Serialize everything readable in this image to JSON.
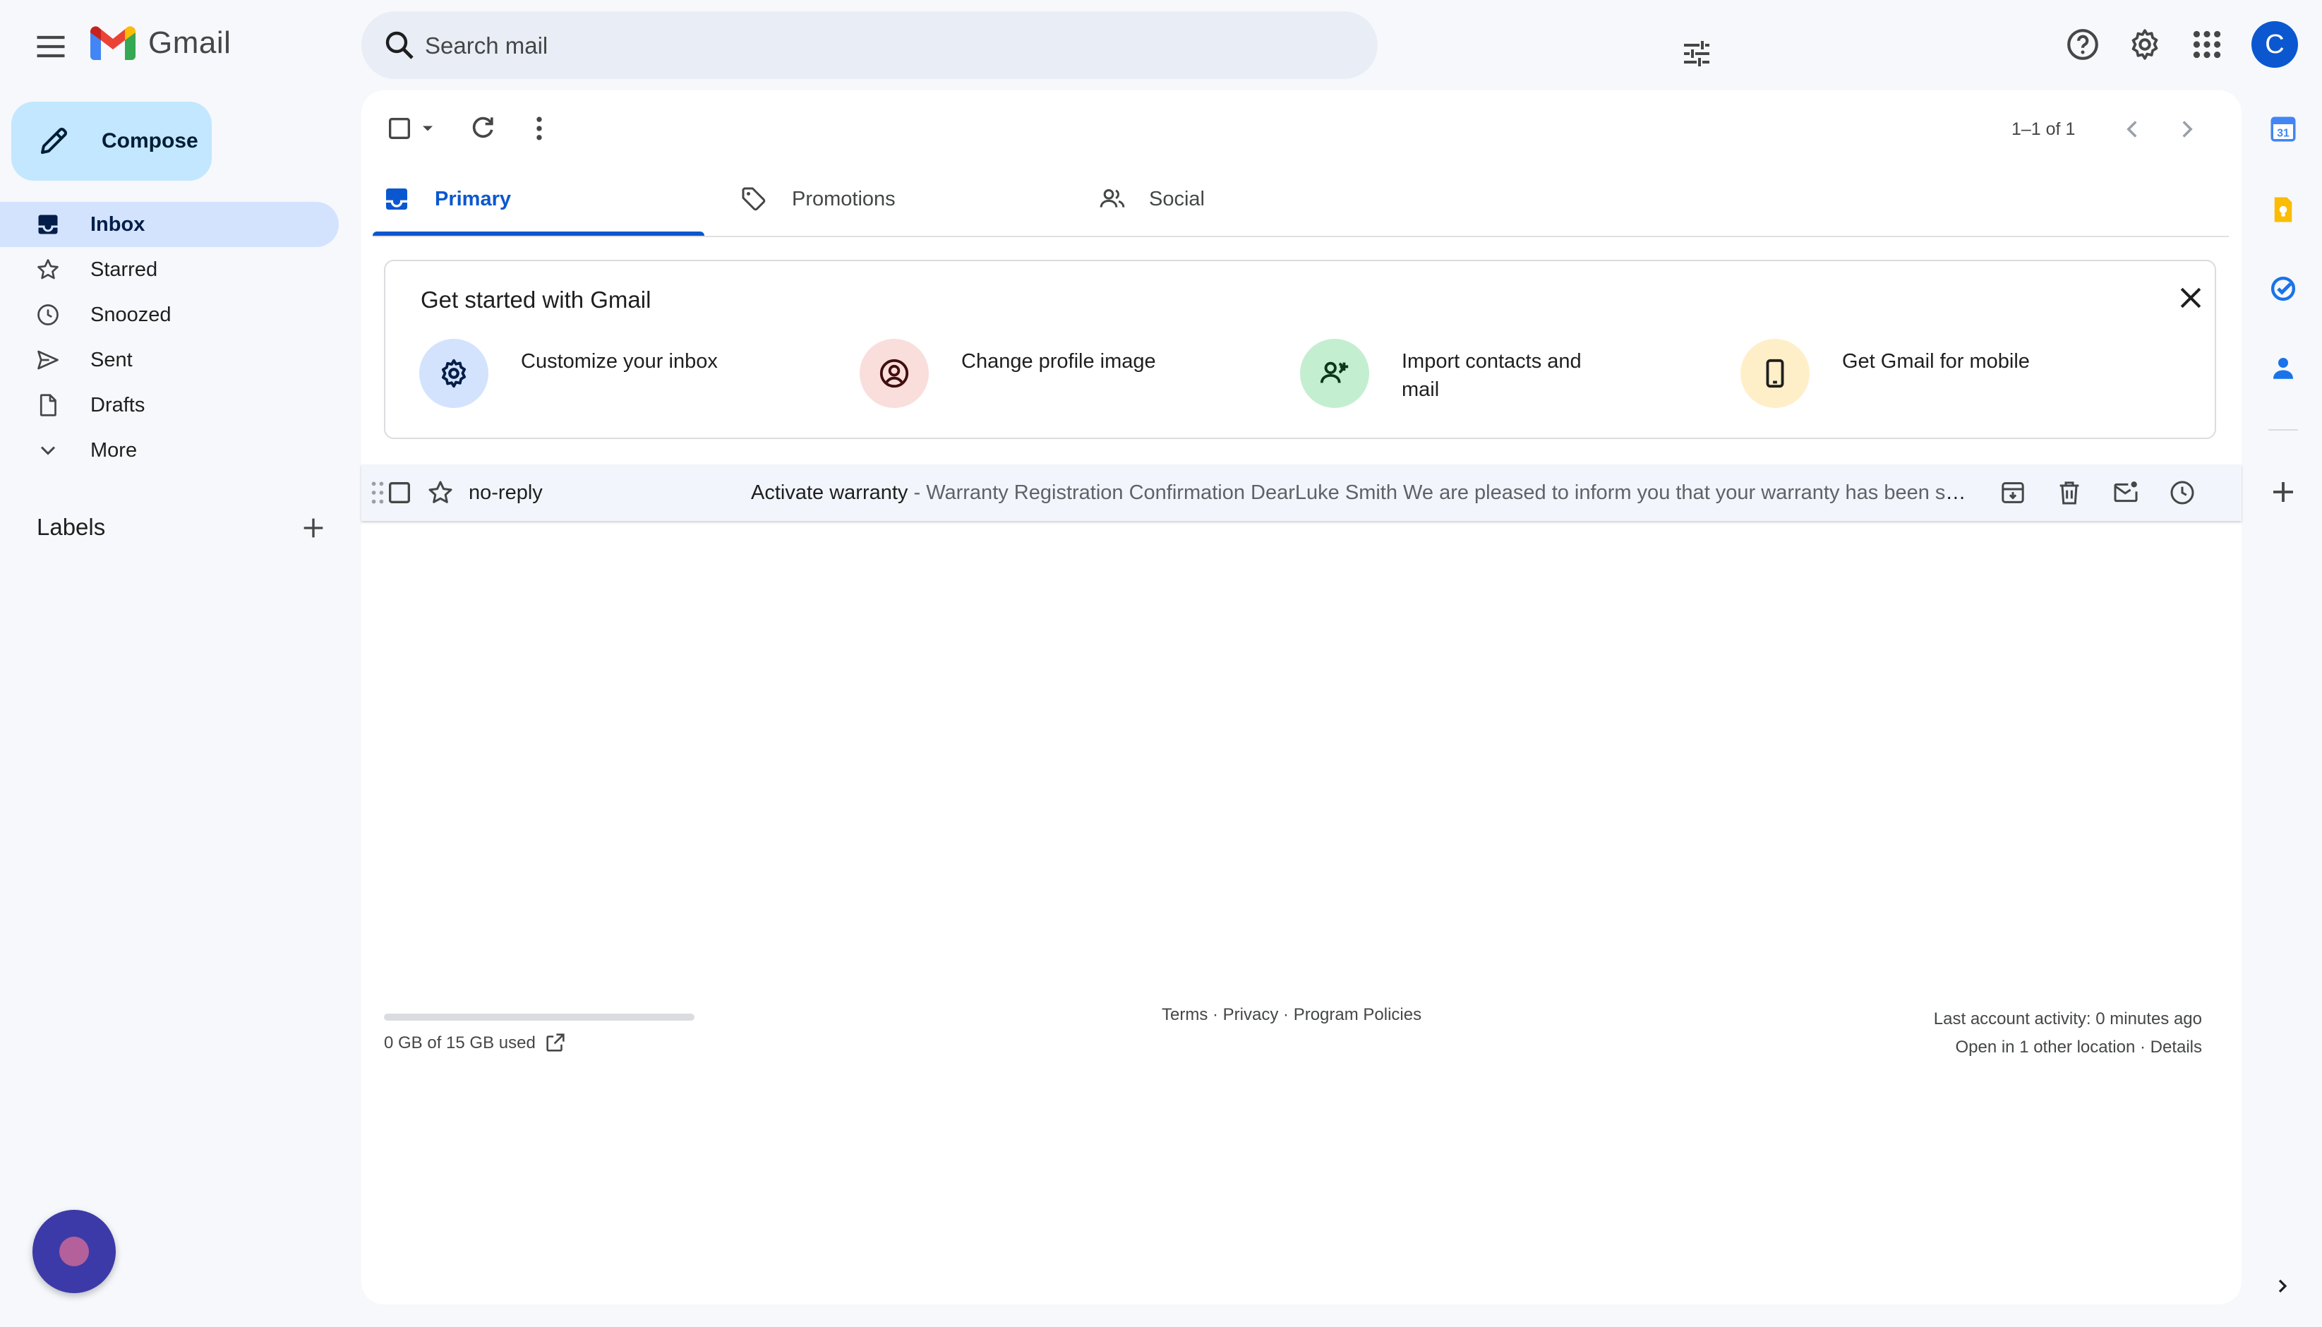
{
  "header": {
    "brand": "Gmail",
    "search_placeholder": "Search mail",
    "avatar_letter": "C",
    "icons": [
      "menu-icon",
      "search-icon",
      "tune-icon",
      "help-icon",
      "settings-icon",
      "apps-icon"
    ]
  },
  "compose_label": "Compose",
  "nav": [
    {
      "label": "Inbox",
      "icon": "inbox-icon",
      "active": true
    },
    {
      "label": "Starred",
      "icon": "star-icon"
    },
    {
      "label": "Snoozed",
      "icon": "clock-icon"
    },
    {
      "label": "Sent",
      "icon": "send-icon"
    },
    {
      "label": "Drafts",
      "icon": "draft-icon"
    },
    {
      "label": "More",
      "icon": "chevron-down-icon"
    }
  ],
  "labels_heading": "Labels",
  "toolbar": {
    "pagination": "1–1 of 1"
  },
  "tabs": [
    {
      "label": "Primary",
      "icon": "inbox-icon",
      "active": true
    },
    {
      "label": "Promotions",
      "icon": "tag-icon"
    },
    {
      "label": "Social",
      "icon": "people-icon"
    }
  ],
  "get_started": {
    "title": "Get started with Gmail",
    "items": [
      {
        "label": "Customize your inbox",
        "icon": "gear-icon",
        "color": "#d3e3fd"
      },
      {
        "label": "Change profile image",
        "icon": "account-icon",
        "color": "#f9dedc"
      },
      {
        "label": "Import contacts and mail",
        "icon": "person-add-icon",
        "color": "#c4eed0"
      },
      {
        "label": "Get Gmail for mobile",
        "icon": "phone-icon",
        "color": "#ffefc9"
      }
    ]
  },
  "emails": [
    {
      "sender": "no-reply",
      "subject": "Activate warranty",
      "snippet": " - Warranty Registration Confirmation DearLuke Smith We are pleased to inform you that your warranty has been successfully registered."
    }
  ],
  "footer": {
    "storage_text": "0 GB of 15 GB used",
    "storage_fraction": 0,
    "links": [
      "Terms",
      "Privacy",
      "Program Policies"
    ],
    "activity": "Last account activity: 0 minutes ago",
    "other_location": "Open in 1 other location",
    "details": "Details"
  },
  "colors": {
    "accent": "#0b57d0",
    "compose_bg": "#c2e7ff",
    "active_nav": "#d3e3fd",
    "page_bg": "#f6f8fc"
  }
}
